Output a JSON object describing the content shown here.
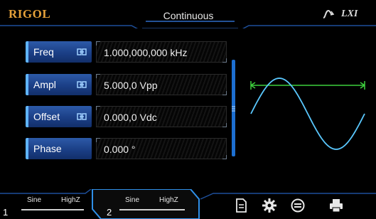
{
  "header": {
    "brand": "RIGOL",
    "mode": "Continuous",
    "lxi_label": "LXI"
  },
  "params": [
    {
      "label": "Freq",
      "value": "1.000,000,000 kHz",
      "linked": true
    },
    {
      "label": "Ampl",
      "value": "5.000,0 Vpp",
      "linked": true
    },
    {
      "label": "Offset",
      "value": "0.000,0 Vdc",
      "linked": true
    },
    {
      "label": "Phase",
      "value": "0.000 °",
      "linked": false
    }
  ],
  "channels": [
    {
      "number": "1",
      "waveform": "Sine",
      "load": "HighZ",
      "active": false
    },
    {
      "number": "2",
      "waveform": "Sine",
      "load": "HighZ",
      "active": true
    }
  ],
  "toolbar": {
    "icons": [
      "file-icon",
      "settings-gear-icon",
      "sync-icon",
      "print-icon"
    ]
  },
  "colors": {
    "brand": "#e6a23a",
    "accent_blue": "#1d6fd1",
    "wave_cyan": "#5ac8ff",
    "marker_green": "#3ecf3e"
  }
}
